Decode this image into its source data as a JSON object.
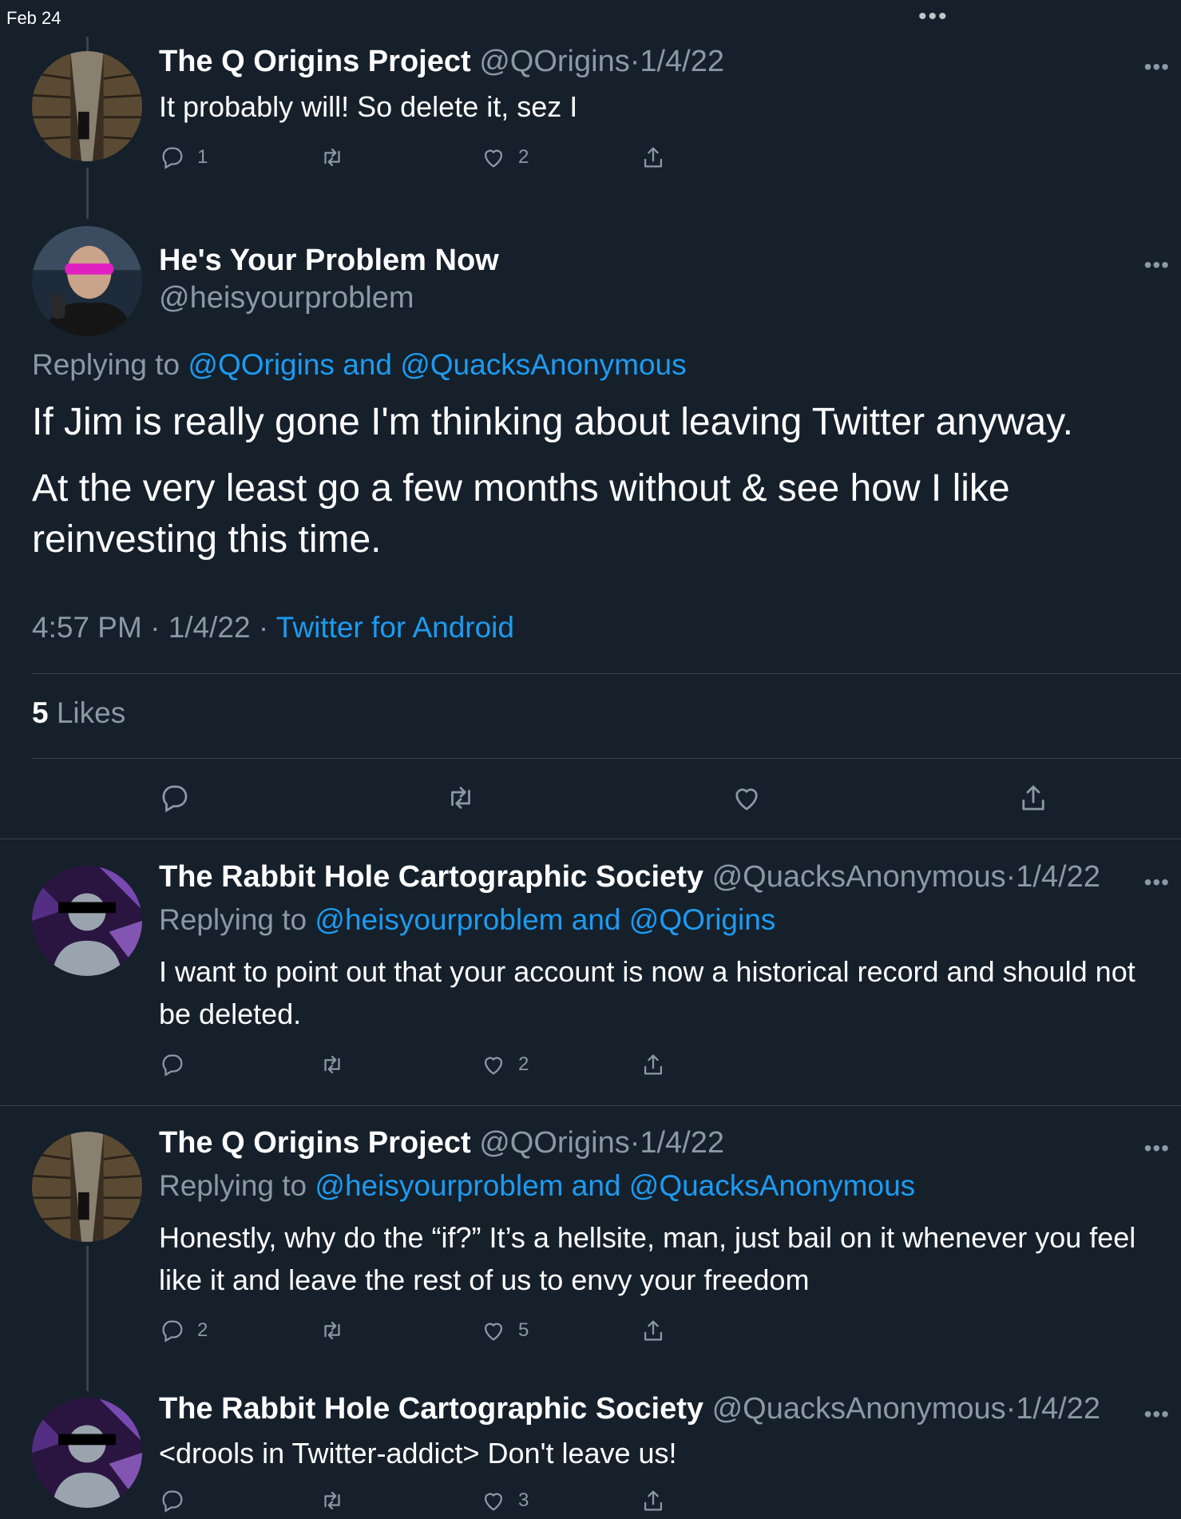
{
  "status_bar": {
    "date": "Feb 24",
    "dots": "•••"
  },
  "tweets": [
    {
      "name": "The Q Origins Project",
      "handle": "@QOrigins",
      "dot": "·",
      "date": "1/4/22",
      "text": "It probably will! So delete it, sez I",
      "counts": {
        "reply": "1",
        "retweet": "",
        "like": "2"
      }
    },
    {
      "name": "The Rabbit Hole Cartographic Society",
      "handle": "@QuacksAnonymous",
      "dot": "·",
      "date": "1/4/22",
      "replying_prefix": "Replying to ",
      "replying_to": "@heisyourproblem and @QOrigins",
      "text": "I want to point out that your account is now a historical record and should not be deleted.",
      "counts": {
        "reply": "",
        "retweet": "",
        "like": "2"
      }
    },
    {
      "name": "The Q Origins Project",
      "handle": "@QOrigins",
      "dot": "·",
      "date": "1/4/22",
      "replying_prefix": "Replying to ",
      "replying_to": "@heisyourproblem and @QuacksAnonymous",
      "text": "Honestly, why do the “if?” It’s a hellsite, man, just bail on it whenever you feel like it and leave the rest of us to envy your freedom",
      "counts": {
        "reply": "2",
        "retweet": "",
        "like": "5"
      }
    },
    {
      "name": "The Rabbit Hole Cartographic Society",
      "handle": "@QuacksAnonymous",
      "dot": "·",
      "date": "1/4/22",
      "text": "<drools in Twitter-addict> Don't leave us!",
      "counts": {
        "reply": "",
        "retweet": "",
        "like": "3"
      }
    }
  ],
  "main_tweet": {
    "name": "He's Your Problem Now",
    "handle": "@heisyourproblem",
    "replying_prefix": "Replying to ",
    "replying_to": "@QOrigins and @QuacksAnonymous",
    "paragraph1": "If Jim is really gone I'm thinking about leaving Twitter anyway.",
    "paragraph2": "At the very least go a few months without & see how I like reinvesting this time.",
    "time": "4:57 PM",
    "dot": "·",
    "date": "1/4/22",
    "source": "Twitter for Android",
    "likes_count": "5",
    "likes_label": "Likes"
  },
  "more_icon": "•••",
  "colors": {
    "background": "#15202b",
    "muted": "#8b98a5",
    "link": "#1d9bf0",
    "divider": "#38444d"
  }
}
